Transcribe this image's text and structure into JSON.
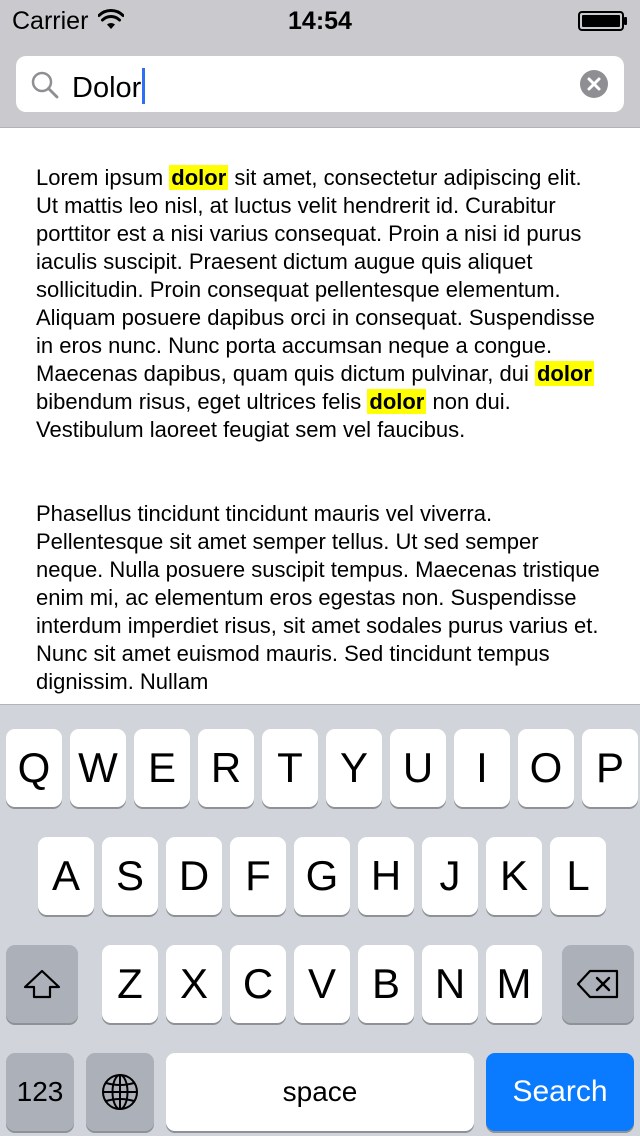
{
  "status_bar": {
    "carrier": "Carrier",
    "time": "14:54"
  },
  "search": {
    "value": "Dolor"
  },
  "content": {
    "paragraphs": [
      [
        {
          "text": "Lorem ipsum ",
          "hl": false
        },
        {
          "text": "dolor",
          "hl": true
        },
        {
          "text": " sit amet, consectetur adipiscing elit. Ut mattis leo nisl, at luctus velit hendrerit id. Curabitur porttitor est a nisi varius consequat. Proin a nisi id purus iaculis suscipit. Praesent dictum augue quis aliquet sollicitudin. Proin consequat pellentesque elementum. Aliquam posuere dapibus orci in consequat. Suspendisse in eros nunc. Nunc porta accumsan neque a congue. Maecenas dapibus, quam quis dictum pulvinar, dui ",
          "hl": false
        },
        {
          "text": "dolor",
          "hl": true
        },
        {
          "text": " bibendum risus, eget ultrices felis ",
          "hl": false
        },
        {
          "text": "dolor",
          "hl": true
        },
        {
          "text": " non dui. Vestibulum laoreet feugiat sem vel faucibus.",
          "hl": false
        }
      ],
      [
        {
          "text": "Phasellus tincidunt tincidunt mauris vel viverra. Pellentesque sit amet semper tellus. Ut sed semper neque. Nulla posuere suscipit tempus. Maecenas tristique enim mi, ac elementum eros egestas non. Suspendisse interdum imperdiet risus, sit amet sodales purus varius et. Nunc sit amet euismod mauris. Sed tincidunt tempus dignissim. Nullam",
          "hl": false
        }
      ]
    ]
  },
  "keyboard": {
    "row1": [
      "Q",
      "W",
      "E",
      "R",
      "T",
      "Y",
      "U",
      "I",
      "O",
      "P"
    ],
    "row2": [
      "A",
      "S",
      "D",
      "F",
      "G",
      "H",
      "J",
      "K",
      "L"
    ],
    "row3": [
      "Z",
      "X",
      "C",
      "V",
      "B",
      "N",
      "M"
    ],
    "numbers_label": "123",
    "space_label": "space",
    "search_label": "Search"
  }
}
